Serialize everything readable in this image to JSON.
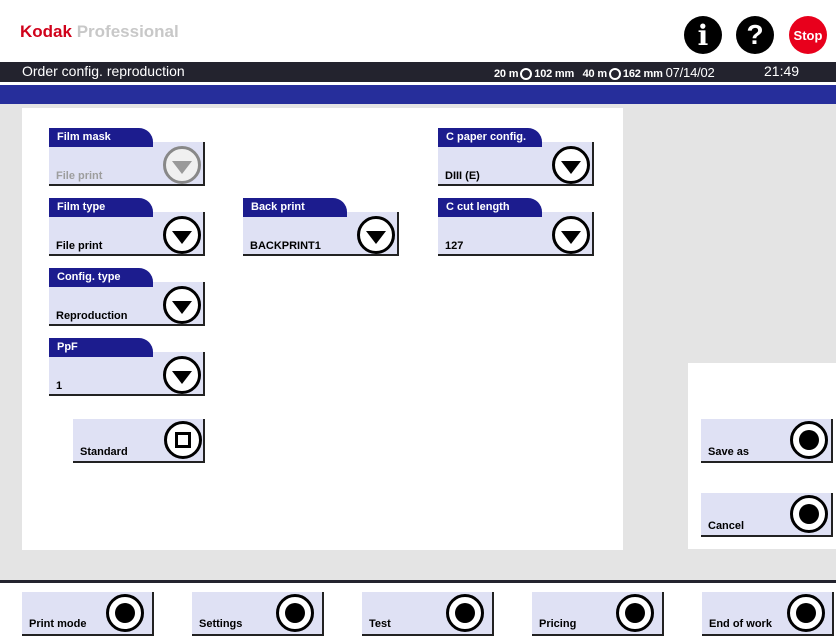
{
  "brand": {
    "name": "Kodak",
    "suffix": "Professional"
  },
  "header": {
    "stop_label": "Stop",
    "info_icon": "i",
    "help_icon": "?",
    "title": "Order config. reproduction",
    "status": {
      "roll1_len": "20 m",
      "roll1_width": "102 mm",
      "roll2_len": "40 m",
      "roll2_width": "162 mm",
      "date": "07/14/02"
    },
    "time": "21:49"
  },
  "fields": {
    "film_mask": {
      "label": "Film mask",
      "value": "File print"
    },
    "film_type": {
      "label": "Film type",
      "value": "File print"
    },
    "config_type": {
      "label": "Config. type",
      "value": "Reproduction"
    },
    "ppf": {
      "label": "PpF",
      "value": "1"
    },
    "back_print": {
      "label": "Back print",
      "value": "BACKPRINT1"
    },
    "c_paper_config": {
      "label": "C paper config.",
      "value": "DIII (E)"
    },
    "c_cut_length": {
      "label": "C cut length",
      "value": "127"
    }
  },
  "standard_label": "Standard",
  "side_actions": {
    "save_as": "Save as",
    "cancel": "Cancel"
  },
  "footer": {
    "print_mode": "Print mode",
    "settings": "Settings",
    "test": "Test",
    "pricing": "Pricing",
    "end_of_work": "End of work"
  },
  "colors": {
    "header_dark": "#23232e",
    "accent_blue": "#262e9b",
    "tab_blue": "#1c1c8e",
    "field_bg": "#dfe1f4",
    "stop_red": "#e8001c",
    "brand_red": "#d0021b"
  }
}
